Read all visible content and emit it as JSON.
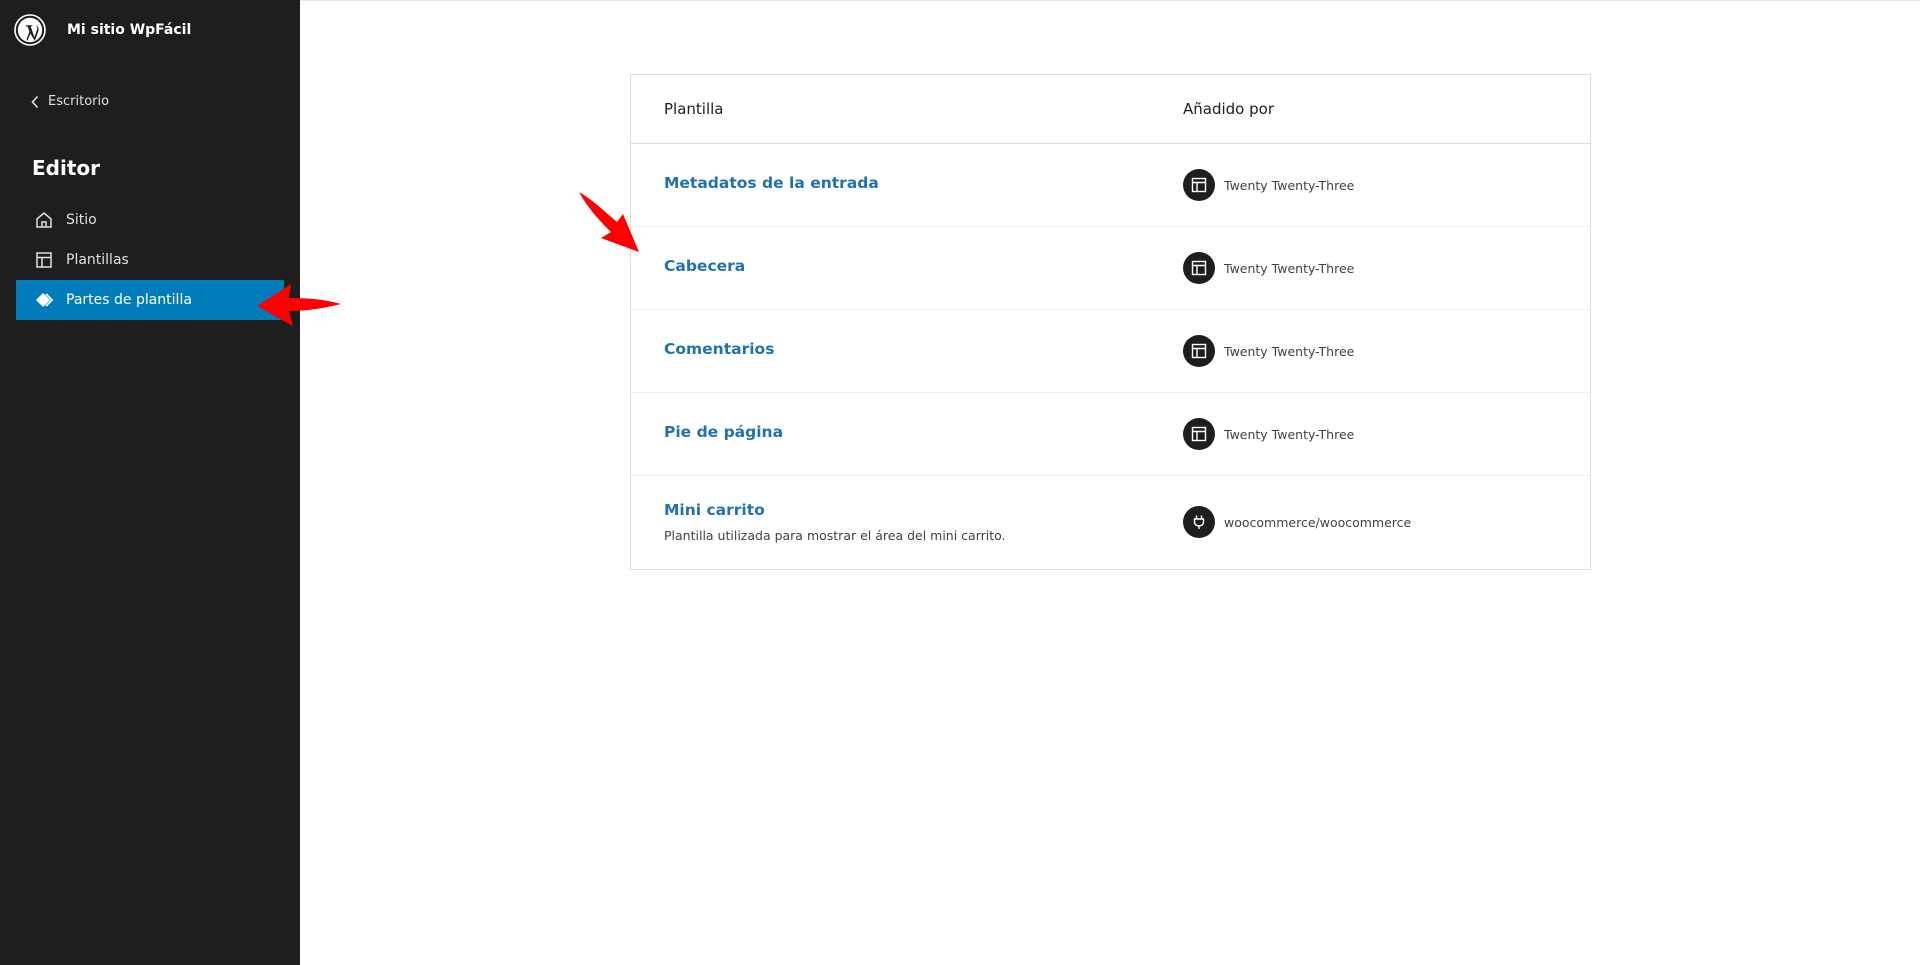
{
  "site": {
    "name": "Mi sitio WpFácil",
    "logo_icon": "wordpress-logo-icon"
  },
  "sidebar": {
    "back_label": "Escritorio",
    "title": "Editor",
    "items": [
      {
        "label": "Sitio",
        "icon": "home-icon",
        "active": false
      },
      {
        "label": "Plantillas",
        "icon": "layout-icon",
        "active": false
      },
      {
        "label": "Partes de plantilla",
        "icon": "symbol-filled-icon",
        "active": true
      }
    ],
    "active_color": "#007cba",
    "background": "#1e1e1e"
  },
  "table": {
    "headers": {
      "template": "Plantilla",
      "added_by": "Añadido por"
    },
    "rows": [
      {
        "title": "Metadatos de la entrada",
        "description": "",
        "author": "Twenty Twenty-Three",
        "author_icon": "layout-icon"
      },
      {
        "title": "Cabecera",
        "description": "",
        "author": "Twenty Twenty-Three",
        "author_icon": "layout-icon"
      },
      {
        "title": "Comentarios",
        "description": "",
        "author": "Twenty Twenty-Three",
        "author_icon": "layout-icon"
      },
      {
        "title": "Pie de página",
        "description": "",
        "author": "Twenty Twenty-Three",
        "author_icon": "layout-icon"
      },
      {
        "title": "Mini carrito",
        "description": "Plantilla utilizada para mostrar el área del mini carrito.",
        "author": "woocommerce/woocommerce",
        "author_icon": "plugin-icon"
      }
    ],
    "link_color": "#2271b1"
  },
  "annotations": {
    "arrow_color": "#ff0000"
  }
}
